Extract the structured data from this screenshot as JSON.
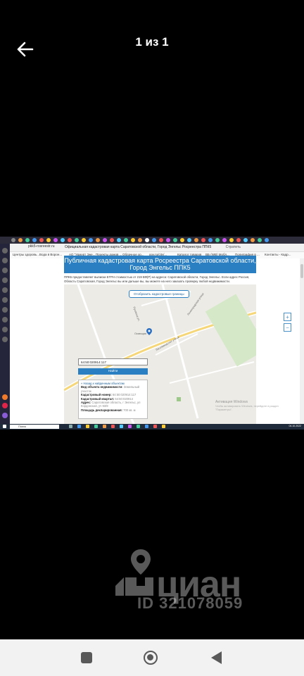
{
  "viewer": {
    "counter": "1 из 1",
    "back_icon": "arrow-left-icon"
  },
  "browser": {
    "url": "pkk5-rosreestr.ru",
    "tab_title": "Официальная кадастровая карта Саратовской области, Город Энгельс Росреестра ППК5",
    "translate_label": "Стратить",
    "bookmarks": [
      "Центры здоровь...",
      "Вода в Ворон...",
      "АО \"Удмурт Эне...",
      "Проекты домов ...",
      "Облачное хр...",
      "gov.ru/city/...",
      "Каталог товаров",
      "ВБ (WB) Мобл...",
      "Полиграфия в ...",
      "Контакты - Кадр..."
    ]
  },
  "page": {
    "banner_title": "Публичная кадастровая карта Росреестра Саратовской области, Город Энгельс ППК5",
    "description": "ППК5 предоставляет выписки ЕГРН стоимостью от 219 ВФ(Р) на адреса: Саратовской области, Город Энгельс. Если адрес Россия, Область Саратовская, Город Энгельс вы или дальше вы, вы можете на него заказать проверку любой недвижимости.",
    "show_button": "Отобразить кадастровые границы",
    "street_labels": [
      "Ленинградская улица",
      "Пушкина ул.",
      "Окающая",
      "Лесозаводская улица"
    ],
    "search_value": "64:50:020914:117",
    "find_button": "Найти",
    "info": {
      "heading": "Назад к найденным объектам",
      "rows": [
        {
          "key": "Вид объекта недвижимости:",
          "value": "Земельный участок"
        },
        {
          "key": "Кадастровый номер:",
          "value": "64:50:020914:117"
        },
        {
          "key": "Кадастровый квартал:",
          "value": "64:50:020914"
        },
        {
          "key": "Адрес:",
          "value": "Саратовская область, г Энгельс, ул Кордонская, уч 93/9"
        },
        {
          "key": "Площадь декларированная:",
          "value": "700 кв. м"
        }
      ]
    },
    "zoom_in": "+",
    "zoom_out": "−",
    "activation_title": "Активация Windows",
    "activation_text": "Чтобы активировать Windows, перейдите в раздел \"Параметры\"."
  },
  "taskbar": {
    "search_placeholder": "Поиск",
    "clock": "04.10.2022"
  },
  "watermark": {
    "brand": "циан",
    "id_text": "ID 321078059"
  },
  "nav": {
    "recent": "recent-apps-icon",
    "home": "home-icon",
    "back": "back-triangle-icon"
  },
  "colors": {
    "banner": "#2a7fc2",
    "viewer_bg": "#000000",
    "navbar_bg": "#f2f2f2"
  }
}
